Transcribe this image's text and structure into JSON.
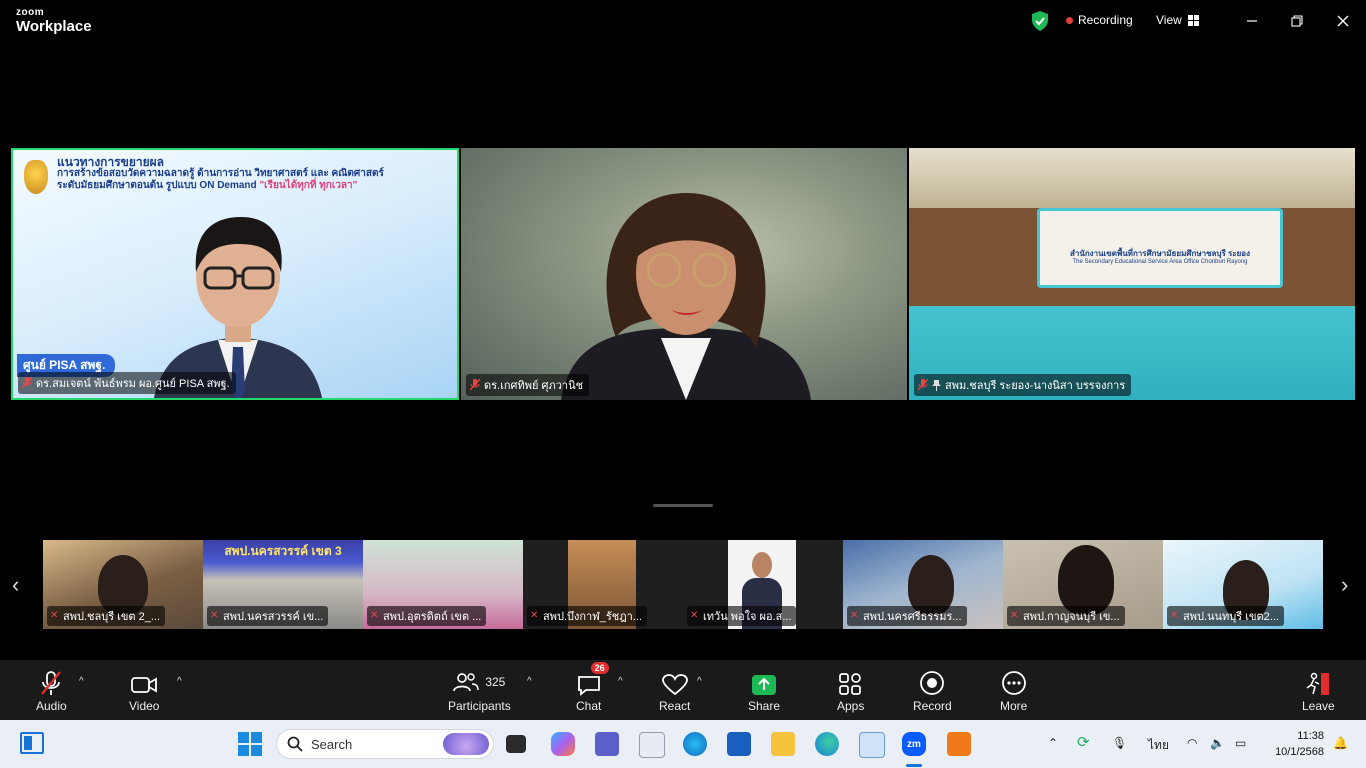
{
  "app": {
    "brand_small": "zoom",
    "brand_large": "Workplace"
  },
  "titlebar": {
    "recording_label": "Recording",
    "view_label": "View"
  },
  "speaker_tiles": [
    {
      "name": "ดร.สมเจตน์ พันธ์พรม ผอ.ศูนย์ PISA สพฐ.",
      "slide_line1": "แนวทางการขยายผล",
      "slide_line2": "การสร้างข้อสอบวัดความฉลาดรู้ ด้านการอ่าน วิทยาศาสตร์ และ คณิตศาสตร์",
      "slide_line3a": "ระดับมัธยมศึกษาตอนต้น รูปแบบ ON Demand",
      "slide_line3b": "\"เรียนได้ทุกที่ ทุกเวลา\"",
      "tag": "ศูนย์ PISA สพฐ."
    },
    {
      "name": "ดร.เกศทิพย์ ศุภวานิช"
    },
    {
      "name": "สพม.ชลบุรี ระยอง-นางนิสา บรรจงการ",
      "banner_line1": "สำนักงานเขตพื้นที่การศึกษามัธยมศึกษาชลบุรี ระยอง",
      "banner_line2": "The Secondary Educational Service Area Office Chonburi Rayong"
    }
  ],
  "thumbnails": [
    {
      "name": "สพป.ชลบุรี เขต 2_..."
    },
    {
      "name": "สพป.นครสวรรค์ เข...",
      "banner": "สพป.นครสวรรค์ เขต 3"
    },
    {
      "name": "สพป.อุตรดิตถ์ เขต ..."
    },
    {
      "name": "สพป.บึงกาฬ_รัชฎา..."
    },
    {
      "name": "เทวัน พอใจ ผอ.ส..."
    },
    {
      "name": "สพป.นครศรีธรรมร..."
    },
    {
      "name": "สพป.กาญจนบุรี เข..."
    },
    {
      "name": "สพป.นนทบุรี เขต2..."
    }
  ],
  "toolbar": {
    "audio": "Audio",
    "video": "Video",
    "participants": "Participants",
    "participants_count": "325",
    "chat": "Chat",
    "chat_badge": "26",
    "react": "React",
    "share": "Share",
    "apps": "Apps",
    "record": "Record",
    "more": "More",
    "leave": "Leave"
  },
  "taskbar": {
    "search_placeholder": "Search",
    "language": "ไทย",
    "time": "11:38",
    "date": "10/1/2568"
  },
  "colors": {
    "active_speaker_border": "#23d96c",
    "recording_dot": "#e0403a",
    "share_green": "#1db954",
    "leave_red": "#e02e2e"
  }
}
